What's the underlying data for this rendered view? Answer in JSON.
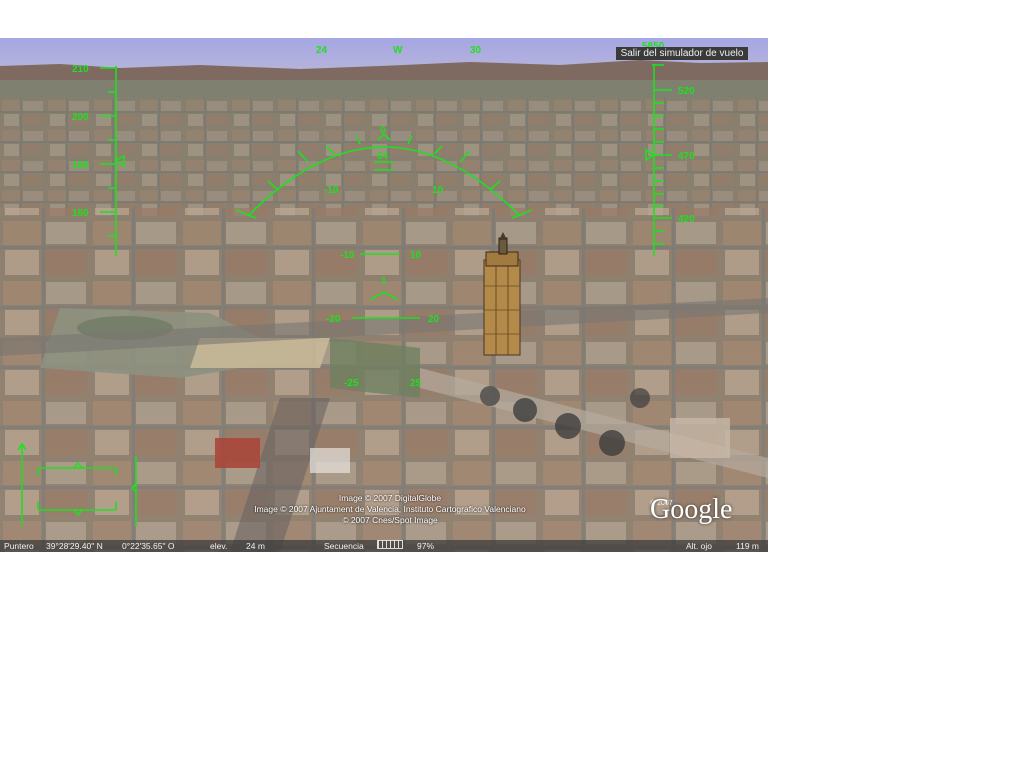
{
  "hud": {
    "compass": {
      "left": "24",
      "center": "W",
      "right": "30"
    },
    "altitude_top": "5850",
    "speed_ladder": [
      "210",
      "200",
      "190",
      "180"
    ],
    "altitude_ladder": [
      "520",
      "470",
      "420"
    ],
    "heading_arc": {
      "top": "0",
      "left": "-10",
      "right": "10",
      "label_top": "64"
    },
    "pitch": {
      "upper_left": "-10",
      "upper_right": "10",
      "lower_left": "-20",
      "lower_right": "20",
      "bottom_left": "-25",
      "bottom_right": "25",
      "mark": "1"
    },
    "color": "#1fe01f"
  },
  "exit_button": {
    "label": "Salir del simulador de vuelo"
  },
  "copyright": {
    "line1": "Image © 2007 DigitalGlobe",
    "line2": "Image © 2007 Ajuntament de Valencia, Instituto Cartografico Valenciano",
    "line3": "© 2007 Cnes/Spot Image"
  },
  "logo": {
    "text": "Google",
    "small": "© 2007"
  },
  "status": {
    "pointer_label": "Puntero",
    "lat": "39°28'29.40\" N",
    "lon": "0°22'35.65\" O",
    "elev_label": "elev.",
    "elev_value": "24 m",
    "sequence_label": "Secuencia",
    "sequence_percent": "97%",
    "eye_label": "Alt. ojo",
    "eye_value": "119 m"
  }
}
